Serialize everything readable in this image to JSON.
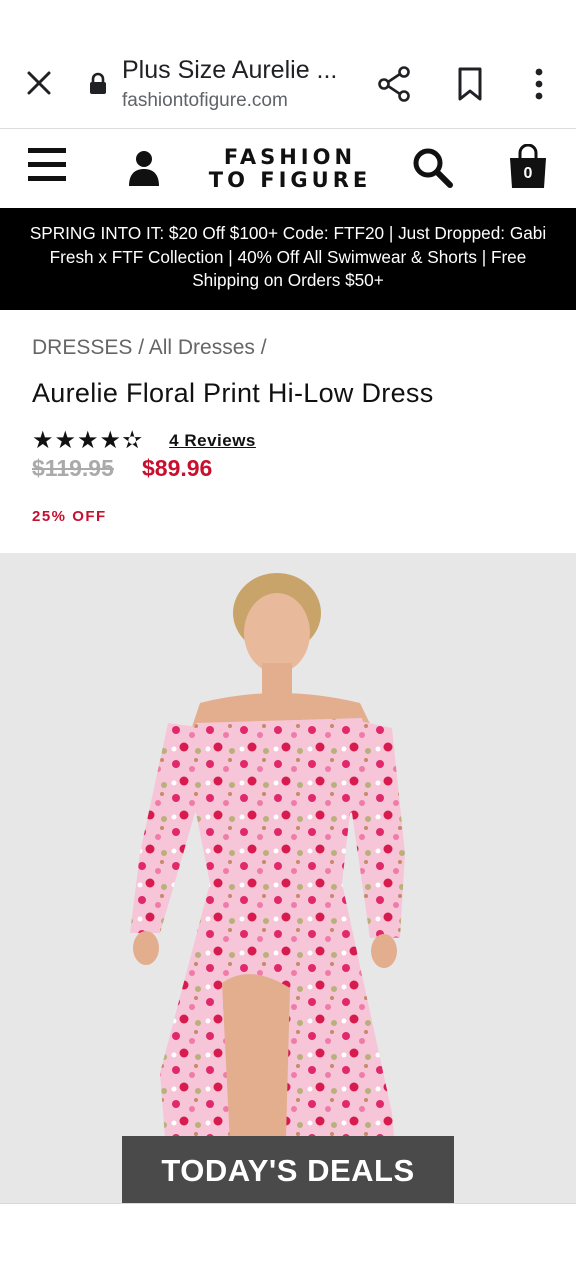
{
  "browser": {
    "title": "Plus Size Aurelie ...",
    "url": "fashiontofigure.com"
  },
  "site": {
    "logo_line1": "FASHION",
    "logo_line2": "TO FIGURE",
    "bag_count": "0"
  },
  "promo": {
    "text": "SPRING INTO IT: $20 Off $100+ Code: FTF20 | Just Dropped: Gabi Fresh x FTF Collection | 40% Off All Swimwear & Shorts | Free Shipping on Orders $50+"
  },
  "product": {
    "breadcrumb": "DRESSES / All Dresses /",
    "title": "Aurelie Floral Print Hi-Low Dress",
    "rating": 4.5,
    "stars": "★★★★✫",
    "reviews": "4 Reviews",
    "price_old": "$119.95",
    "price_new": "$89.96",
    "discount": "25% OFF"
  },
  "deals_banner": "TODAY'S DEALS",
  "colors": {
    "accent": "#c8102e",
    "banner": "#000000"
  }
}
